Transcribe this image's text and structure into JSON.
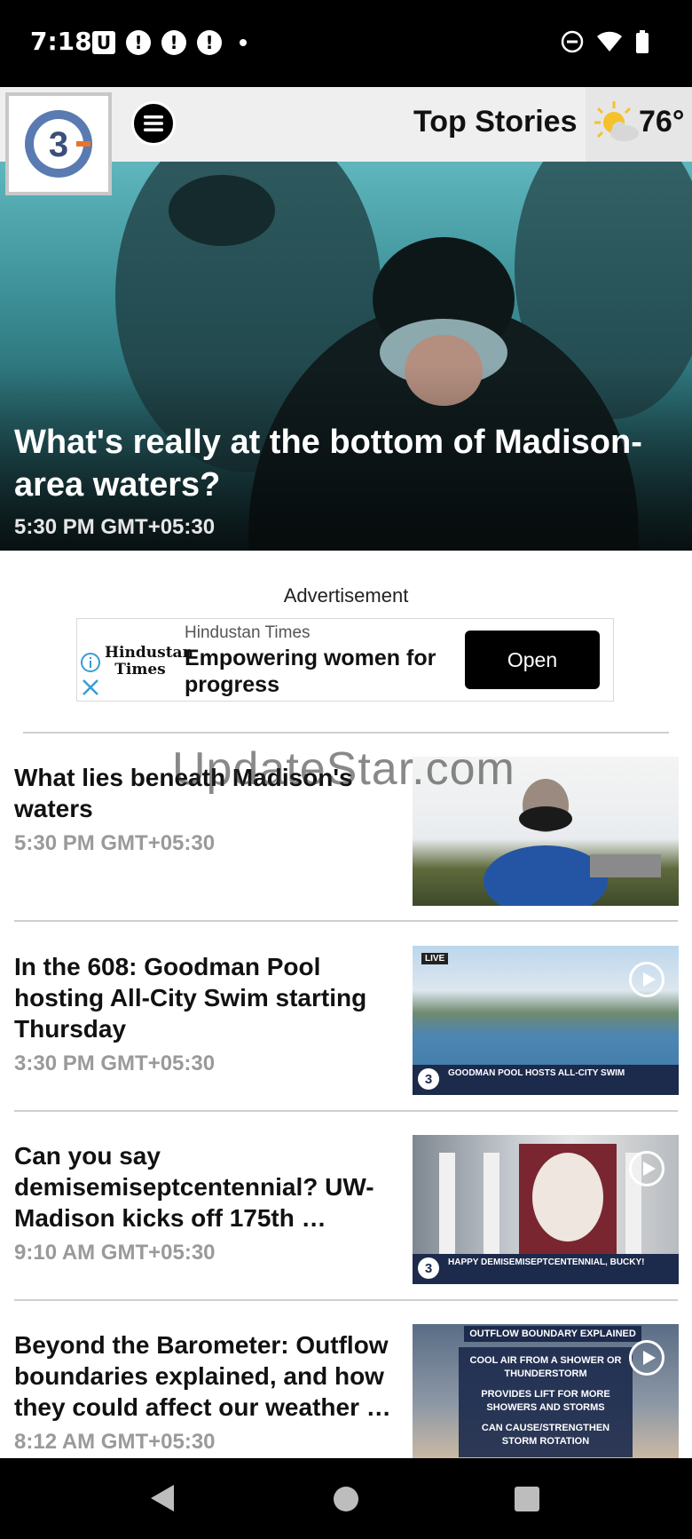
{
  "status_bar": {
    "time": "7:18",
    "left_icons": [
      "u-notification-icon",
      "alert-icon",
      "alert-icon",
      "alert-icon",
      "dot-icon"
    ],
    "right_icons": [
      "do-not-disturb-icon",
      "wifi-icon",
      "battery-icon"
    ]
  },
  "header": {
    "logo_icon": "channel-3-logo",
    "menu_icon": "hamburger-menu-icon",
    "title": "Top Stories",
    "weather_icon": "partly-sunny-icon",
    "temperature": "76°"
  },
  "hero": {
    "title": "What's really at the bottom of Madison-area waters?",
    "time": "5:30 PM GMT+05:30"
  },
  "ad": {
    "label": "Advertisement",
    "logo_text": "Hindustan Times",
    "source": "Hindustan Times",
    "headline": "Empowering women for progress",
    "button": "Open"
  },
  "watermark": "UpdateStar.com",
  "stories": [
    {
      "title": "What lies beneath Madison's waters",
      "time": "5:30 PM GMT+05:30"
    },
    {
      "title": "In the 608: Goodman Pool hosting All-City Swim starting Thursday",
      "time": "3:30 PM GMT+05:30",
      "thumb_live": "LIVE",
      "thumb_caption": "GOODMAN POOL HOSTS ALL-CITY SWIM"
    },
    {
      "title": "Can you say demisemiseptcentennial? UW-Madison kicks off 175th …",
      "time": "9:10 AM GMT+05:30",
      "thumb_caption": "HAPPY DEMISEMISEPTCENTENNIAL, BUCKY!"
    },
    {
      "title": "Beyond the Barometer: Outflow boundaries explained, and how they could affect our weather …",
      "time": "8:12 AM GMT+05:30",
      "thumb_caption": "OUTFLOW BOUNDARY EXPLAINED",
      "thumb_lines": [
        "COOL AIR FROM A SHOWER OR THUNDERSTORM",
        "PROVIDES LIFT FOR MORE SHOWERS AND STORMS",
        "CAN CAUSE/STRENGTHEN STORM ROTATION"
      ]
    }
  ],
  "nav_bar": [
    "back-icon",
    "home-icon",
    "recents-icon"
  ]
}
